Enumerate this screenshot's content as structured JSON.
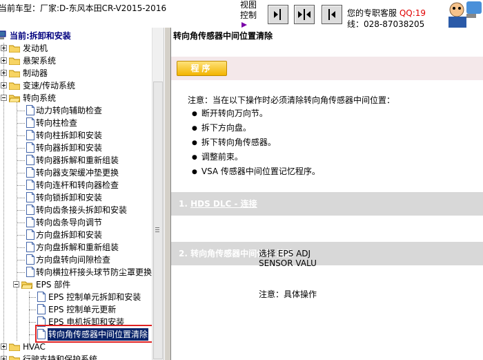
{
  "header": {
    "vehicle_label": "当前车型：厂家:D-东风本田CR-V2015-2016",
    "view_control": "视图控制",
    "service_label": "您的专职客服",
    "qq_label": "QQ:19",
    "phone_label": "线：028-87038205",
    "buttons": [
      {
        "name": "view-left-icon"
      },
      {
        "name": "view-split-icon"
      },
      {
        "name": "view-right-icon"
      }
    ]
  },
  "tree": {
    "root_label": "当前:拆卸和安装",
    "top_items": [
      "发动机",
      "悬架系统",
      "制动器",
      "变速/传动系统",
      "转向系统"
    ],
    "steering_items": [
      "动力转向辅助检查",
      "转向柱检查",
      "转向柱拆卸和安装",
      "转向器拆卸和安装",
      "转向器拆解和重新组装",
      "转向器支架缓冲垫更换",
      "转向连杆和转向器检查",
      "转向锁拆卸和安装",
      "转向齿条接头拆卸和安装",
      "转向齿条导向调节",
      "方向盘拆卸和安装",
      "方向盘拆解和重新组装",
      "方向盘转向间隙检查",
      "转向横拉杆接头球节防尘罩更换"
    ],
    "eps_label": "EPS 部件",
    "eps_items": [
      "EPS 控制单元拆卸和安装",
      "EPS 控制单元更新",
      "EPS 电机拆卸和安装",
      "转向角传感器中间位置清除"
    ],
    "bottom_items": [
      "HVAC",
      "行驶支持和保护系统"
    ]
  },
  "content": {
    "title": "转向角传感器中间位置清除",
    "program_button": "程序",
    "note_intro": "注意：当在以下操作时必须清除转向角传感器中间位置：",
    "note_items": [
      "断开转向万向节。",
      "拆下方向盘。",
      "拆下转向角传感器。",
      "调整前束。",
      "VSA 传感器中间位置记忆程序。"
    ],
    "step1_prefix": "1. ",
    "step1_link": "HDS DLC - 连接",
    "step2_label": "2. 转向角传感器中间位置-清除",
    "select_line1": "选择  EPS ADJ",
    "select_line2": "SENSOR VALU",
    "select_note": "注意：具体操作"
  },
  "colors": {
    "selected_bg": "#0a246a",
    "highlight_border": "#e02020",
    "step_bar": "#d8d8d8",
    "program_bar": "#f4e8ea",
    "program_button": "#f2b400"
  }
}
